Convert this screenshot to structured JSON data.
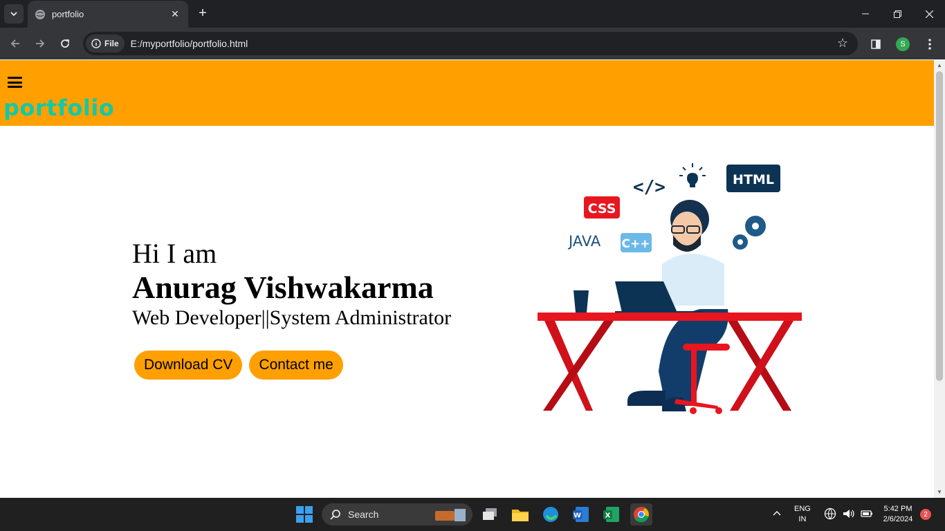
{
  "browser": {
    "tab_title": "portfolio",
    "chip_label": "File",
    "url": "E:/myportfolio/portfolio.html",
    "profile_initial": "S"
  },
  "site": {
    "logo": "portfolio",
    "header_color": "#ffa000",
    "hero": {
      "greeting": "Hi I am",
      "name": "Anurag Vishwakarma",
      "role": "Web Developer||System Administrator"
    },
    "buttons": {
      "download": "Download CV",
      "contact": "Contact me"
    },
    "illustration": {
      "labels": [
        "CSS",
        "HTML",
        "JAVA",
        "C++",
        "</>"
      ]
    }
  },
  "taskbar": {
    "search_placeholder": "Search",
    "lang_top": "ENG",
    "lang_bottom": "IN",
    "time": "5:42 PM",
    "date": "2/6/2024",
    "notification_count": "2"
  }
}
